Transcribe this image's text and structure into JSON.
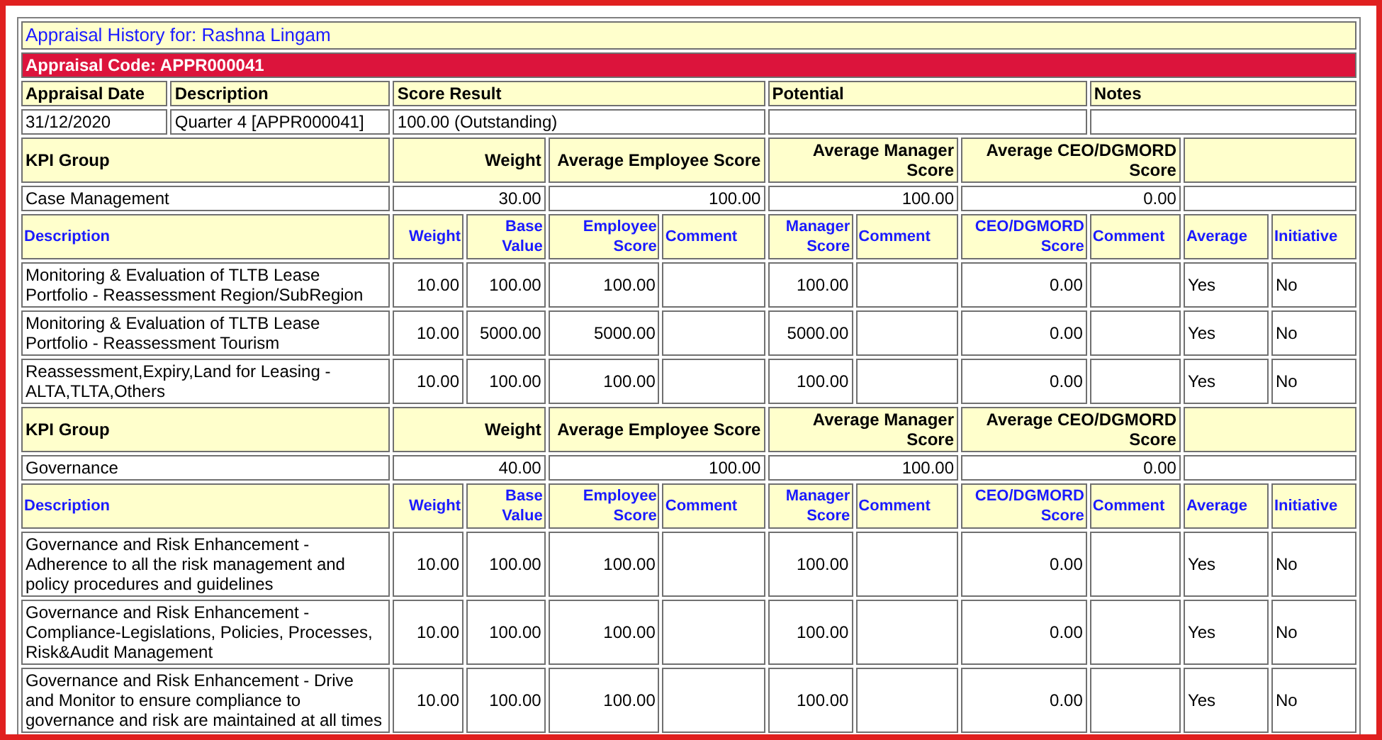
{
  "title": "Appraisal History for: Rashna Lingam",
  "code_bar": "Appraisal Code: APPR000041",
  "summary": {
    "columns": [
      "Appraisal Date",
      "Description",
      "Score Result",
      "Potential",
      "Notes"
    ],
    "appraisal_date": "31/12/2020",
    "description": "Quarter 4 [APPR000041]",
    "score_result": "100.00 (Outstanding)"
  },
  "kpi_groups": [
    {
      "group_columns": [
        "KPI Group",
        "Weight",
        "Average Employee Score",
        "Average Manager Score",
        "Average CEO/DGMORD Score"
      ],
      "name": "Case Management",
      "weight": "30.00",
      "avg_employee": "100.00",
      "avg_manager": "100.00",
      "avg_ceo": "0.00",
      "item_columns": [
        "Description",
        "Weight",
        "Base Value",
        "Employee Score",
        "Comment",
        "Manager Score",
        "Comment",
        "CEO/DGMORD Score",
        "Comment",
        "Average",
        "Initiative"
      ],
      "items": [
        {
          "description": "Monitoring & Evaluation of TLTB Lease Portfolio - Reassessment Region/SubRegion",
          "weight": "10.00",
          "base_value": "100.00",
          "employee_score": "100.00",
          "manager_score": "100.00",
          "ceo_score": "0.00",
          "average": "Yes",
          "initiative": "No"
        },
        {
          "description": "Monitoring & Evaluation of TLTB Lease Portfolio - Reassessment Tourism",
          "weight": "10.00",
          "base_value": "5000.00",
          "employee_score": "5000.00",
          "manager_score": "5000.00",
          "ceo_score": "0.00",
          "average": "Yes",
          "initiative": "No"
        },
        {
          "description": "Reassessment,Expiry,Land for Leasing - ALTA,TLTA,Others",
          "weight": "10.00",
          "base_value": "100.00",
          "employee_score": "100.00",
          "manager_score": "100.00",
          "ceo_score": "0.00",
          "average": "Yes",
          "initiative": "No"
        }
      ]
    },
    {
      "group_columns": [
        "KPI Group",
        "Weight",
        "Average Employee Score",
        "Average Manager Score",
        "Average CEO/DGMORD Score"
      ],
      "name": "Governance",
      "weight": "40.00",
      "avg_employee": "100.00",
      "avg_manager": "100.00",
      "avg_ceo": "0.00",
      "item_columns": [
        "Description",
        "Weight",
        "Base Value",
        "Employee Score",
        "Comment",
        "Manager Score",
        "Comment",
        "CEO/DGMORD Score",
        "Comment",
        "Average",
        "Initiative"
      ],
      "items": [
        {
          "description": "Governance and Risk Enhancement - Adherence to all the risk management and policy procedures and guidelines",
          "weight": "10.00",
          "base_value": "100.00",
          "employee_score": "100.00",
          "manager_score": "100.00",
          "ceo_score": "0.00",
          "average": "Yes",
          "initiative": "No"
        },
        {
          "description": "Governance and Risk Enhancement - Compliance-Legislations, Policies, Processes, Risk&Audit Management",
          "weight": "10.00",
          "base_value": "100.00",
          "employee_score": "100.00",
          "manager_score": "100.00",
          "ceo_score": "0.00",
          "average": "Yes",
          "initiative": "No"
        },
        {
          "description": "Governance and Risk Enhancement - Drive and Monitor to ensure compliance to governance and risk are maintained at all times",
          "weight": "10.00",
          "base_value": "100.00",
          "employee_score": "100.00",
          "manager_score": "100.00",
          "ceo_score": "0.00",
          "average": "Yes",
          "initiative": "No"
        }
      ]
    }
  ]
}
